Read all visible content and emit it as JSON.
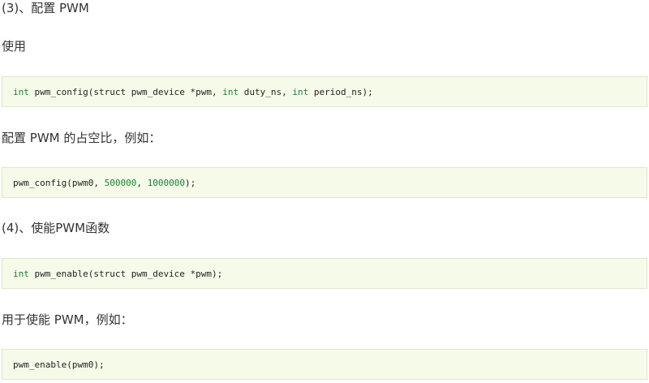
{
  "sections": [
    {
      "heading": "(3)、配置 PWM",
      "intro": "使用",
      "signature": {
        "kw1": "int",
        "text1": " pwm_config(struct pwm_device *pwm, ",
        "kw2": "int",
        "text2": " duty_ns, ",
        "kw3": "int",
        "text3": " period_ns);"
      },
      "example_label": "配置 PWM 的占空比，例如：",
      "example": {
        "text1": "pwm_config(pwm0, ",
        "num1": "500000",
        "text2": ", ",
        "num2": "1000000",
        "text3": ");"
      }
    },
    {
      "heading": "(4)、使能PWM函数",
      "signature": {
        "kw1": "int",
        "text1": " pwm_enable(struct pwm_device *pwm);"
      },
      "example_label": "用于使能 PWM，例如：",
      "example": {
        "text1": "pwm_enable(pwm0);"
      }
    }
  ]
}
